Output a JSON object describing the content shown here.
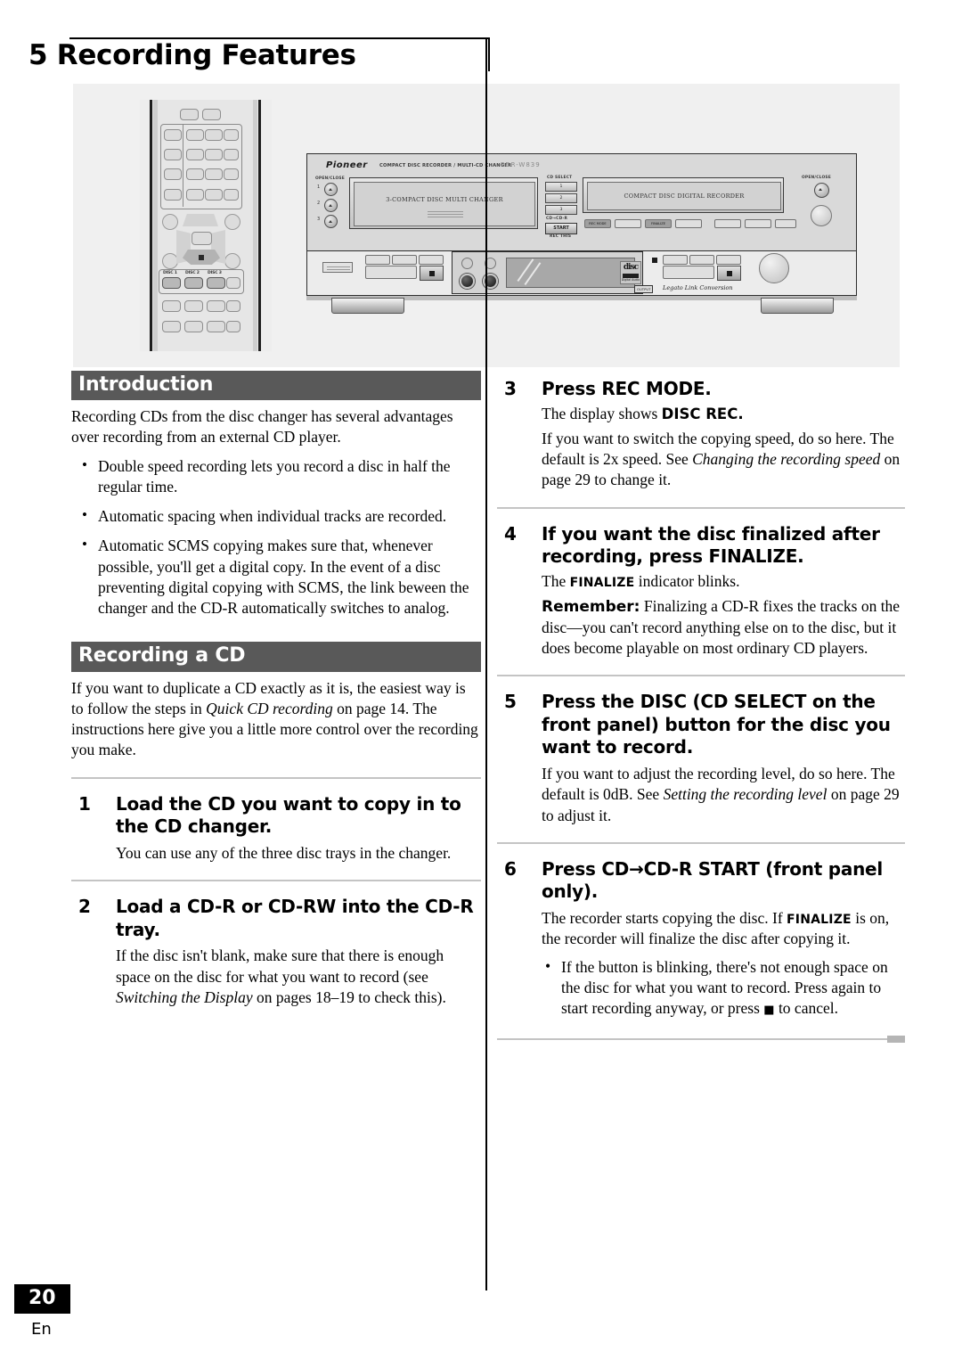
{
  "page": {
    "chapter_title": "5 Recording Features",
    "number": "20",
    "language": "En"
  },
  "illustration": {
    "remote": {
      "disc_buttons": [
        "DISC 1",
        "DISC 2",
        "DISC 3"
      ]
    },
    "stereo": {
      "brand": "Pioneer",
      "product_line": "COMPACT DISC RECORDER / MULTI-CD CHANGER",
      "model": "PDR-W839",
      "open_close_left": "OPEN/CLOSE",
      "open_close_right": "OPEN/CLOSE",
      "tray_numbers": [
        "1",
        "2",
        "3"
      ],
      "changer_tray_label": "3-COMPACT DISC MULTI CHANGER",
      "recorder_tray_label": "COMPACT DISC DIGITAL RECORDER",
      "cd_select_label": "CD SELECT",
      "cd_select_buttons": [
        "1",
        "2",
        "3"
      ],
      "cd_to_cdr_label": "CD→CD-R",
      "start_button": "START",
      "rec_this_label": "REC THIS",
      "rec_mode_button": "REC MODE",
      "finalize_button": "FINALIZE",
      "output_badge": "OUTPUT",
      "legato": "Legato Link Conversion",
      "cd_logo_title": "disc",
      "cd_logo_sub": "Digital Audio"
    }
  },
  "left_column": {
    "intro": {
      "heading": "Introduction",
      "paragraph": "Recording CDs from the disc changer has several advantages over recording from an external CD player.",
      "bullets": [
        "Double speed recording lets you record a disc in half the regular time.",
        "Automatic spacing when individual tracks are recorded.",
        "Automatic SCMS copying makes sure that, whenever possible, you'll get a digital copy. In the event of a disc preventing digital copying with SCMS, the link beween the changer and the CD-R automatically switches to analog."
      ]
    },
    "recording": {
      "heading": "Recording a CD",
      "paragraph_parts": {
        "before": "If you want to duplicate a CD exactly as it is, the easiest way is to follow the steps in ",
        "italic": "Quick CD recording",
        "after": " on page 14. The instructions here give you a little more control over the recording you make."
      }
    },
    "steps": [
      {
        "number": "1",
        "title": "Load the CD you want to copy in to the CD changer.",
        "body": "You can use any of the three disc trays in the changer."
      },
      {
        "number": "2",
        "title": "Load a CD-R or CD-RW into the CD-R tray.",
        "body_parts": {
          "before": "If the disc isn't blank, make sure that there is enough space on the disc for what you want to record (see ",
          "italic": "Switching the Display",
          "after": " on pages 18–19 to check this)."
        }
      }
    ]
  },
  "right_column": {
    "steps": [
      {
        "number": "3",
        "title": "Press REC MODE.",
        "body1_before": "The display shows ",
        "body1_bold": "DISC REC.",
        "body2_before": "If you want to switch the copying speed, do so here. The default is 2x speed. See ",
        "body2_italic": "Changing the recording speed",
        "body2_after": " on page 29 to change it."
      },
      {
        "number": "4",
        "title": "If you want the disc finalized after recording, press FINALIZE.",
        "body1_before": "The ",
        "body1_bold": "FINALIZE",
        "body1_after": " indicator blinks.",
        "body2_bold": "Remember:",
        "body2_text": " Finalizing a CD-R fixes the tracks on the disc—you can't record anything else on to the disc, but it does become playable on most ordinary CD players."
      },
      {
        "number": "5",
        "title": "Press the DISC (CD SELECT on the front panel) button for the disc you want to record.",
        "body_before": "If you want to adjust the recording level, do so here. The default is 0dB. See ",
        "body_italic": "Setting the recording level",
        "body_after": " on page 29 to adjust it."
      },
      {
        "number": "6",
        "title_part1": "Press CD",
        "title_arrow": "→",
        "title_part2": "CD-R START (front panel only).",
        "body_before": "The recorder starts copying the disc. If ",
        "body_bold": "FINALIZE",
        "body_after": " is on, the recorder will finalize the disc after copying it.",
        "bullet_before": "If the button is blinking, there's not enough space on the disc for what you want to record. Press again to start recording anyway, or press ",
        "bullet_glyph": "■",
        "bullet_after": " to cancel."
      }
    ]
  }
}
